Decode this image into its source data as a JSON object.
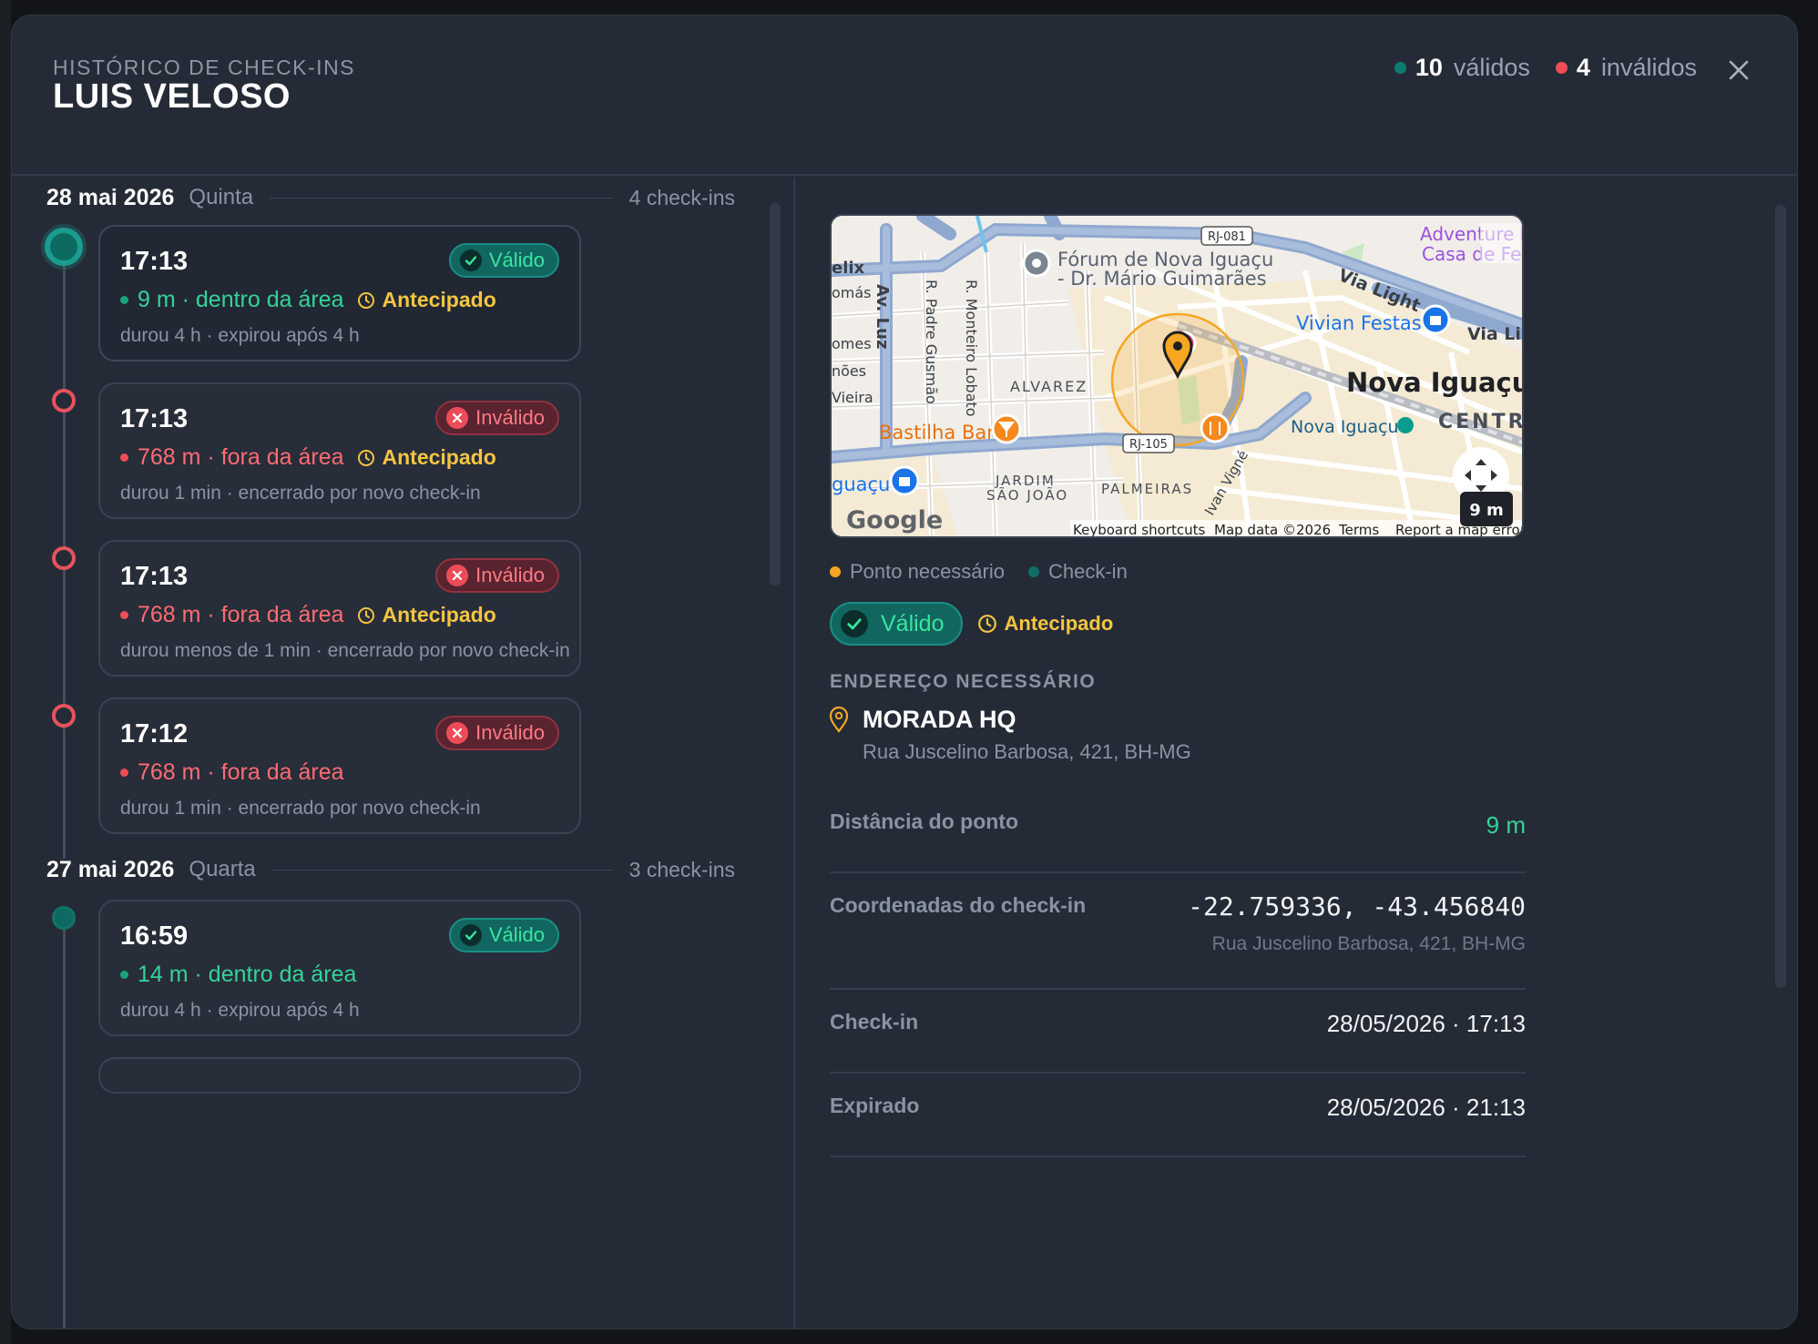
{
  "header": {
    "eyebrow": "HISTÓRICO DE CHECK-INS",
    "name": "LUIS VELOSO",
    "valid_count": "10",
    "valid_label": "válidos",
    "invalid_count": "4",
    "invalid_label": "inválidos"
  },
  "colors": {
    "valid": "#1aa37a",
    "invalid": "#ef4d57",
    "early": "#f5c542",
    "accent_teal": "#0f6e66"
  },
  "days": [
    {
      "date": "28 mai 2026",
      "weekday": "Quinta",
      "count": "4 check-ins",
      "checkins": [
        {
          "time": "17:13",
          "status": "Válido",
          "distance": "9 m · dentro da área",
          "early": "Antecipado",
          "detail": "durou 4 h · expirou após 4 h"
        },
        {
          "time": "17:13",
          "status": "Inválido",
          "distance": "768 m · fora da área",
          "early": "Antecipado",
          "detail": "durou 1 min · encerrado por novo check-in"
        },
        {
          "time": "17:13",
          "status": "Inválido",
          "distance": "768 m · fora da área",
          "early": "Antecipado",
          "detail": "durou menos de 1 min · encerrado por novo check-in"
        },
        {
          "time": "17:12",
          "status": "Inválido",
          "distance": "768 m · fora da área",
          "detail": "durou 1 min · encerrado por novo check-in"
        }
      ]
    },
    {
      "date": "27 mai 2026",
      "weekday": "Quarta",
      "count": "3 check-ins",
      "checkins": [
        {
          "time": "16:59",
          "status": "Válido",
          "distance": "14 m · dentro da área",
          "detail": "durou 4 h · expirou após 4 h"
        }
      ]
    }
  ],
  "map": {
    "labels": {
      "forum": "Fórum de Nova Iguaçu\n- Dr. Mário Guimarães",
      "forum_1": "Fórum de Nova Iguaçu",
      "forum_2": "- Dr. Mário Guimarães",
      "adventure": "Adventure K",
      "casa": "Casa de Fes",
      "rj081": "RJ-081",
      "via_light": "Via Light",
      "via_lig": "Via Lig",
      "vivian": "Vivian Festas",
      "nova_iguacu": "Nova Iguaçu",
      "nova_iguacu_station": "Nova Iguaçu",
      "centro": "CENTR",
      "alvarez": "ALVAREZ",
      "av_luz": "Av. Luz",
      "padre": "R. Padre Gusmão",
      "monteiro": "R. Monteiro Lobato",
      "bastilha": "Bastilha Bar",
      "rj105": "RJ-105",
      "jardim": "JARDIM",
      "sao_joao": "SÃO JOÃO",
      "palmeiras": "PALMEIRAS",
      "ivan": "Ivan Vigné",
      "guacu": "guaçu",
      "elix": "elix",
      "omas": "omás",
      "omes": "omes",
      "noes": "nões",
      "vieira": "Vieira",
      "google": "Google",
      "shortcuts": "Keyboard shortcuts",
      "mapdata": "Map data ©2026",
      "terms": "Terms",
      "report": "Report a map error",
      "scale": "9 m"
    }
  },
  "legend": {
    "required": "Ponto necessário",
    "checkin": "Check-in"
  },
  "detail": {
    "status": "Válido",
    "early": "Antecipado",
    "address_title": "ENDEREÇO NECESSÁRIO",
    "address_name": "MORADA HQ",
    "address_sub": "Rua Juscelino Barbosa, 421, BH-MG",
    "distance_label": "Distância do ponto",
    "distance_value": "9 m",
    "coords_label": "Coordenadas do check-in",
    "coords_value": "-22.759336, -43.456840",
    "coords_sub": "Rua Juscelino Barbosa, 421, BH-MG",
    "checkin_label": "Check-in",
    "checkin_value": "28/05/2026 · 17:13",
    "expired_label": "Expirado",
    "expired_value": "28/05/2026 · 21:13"
  }
}
